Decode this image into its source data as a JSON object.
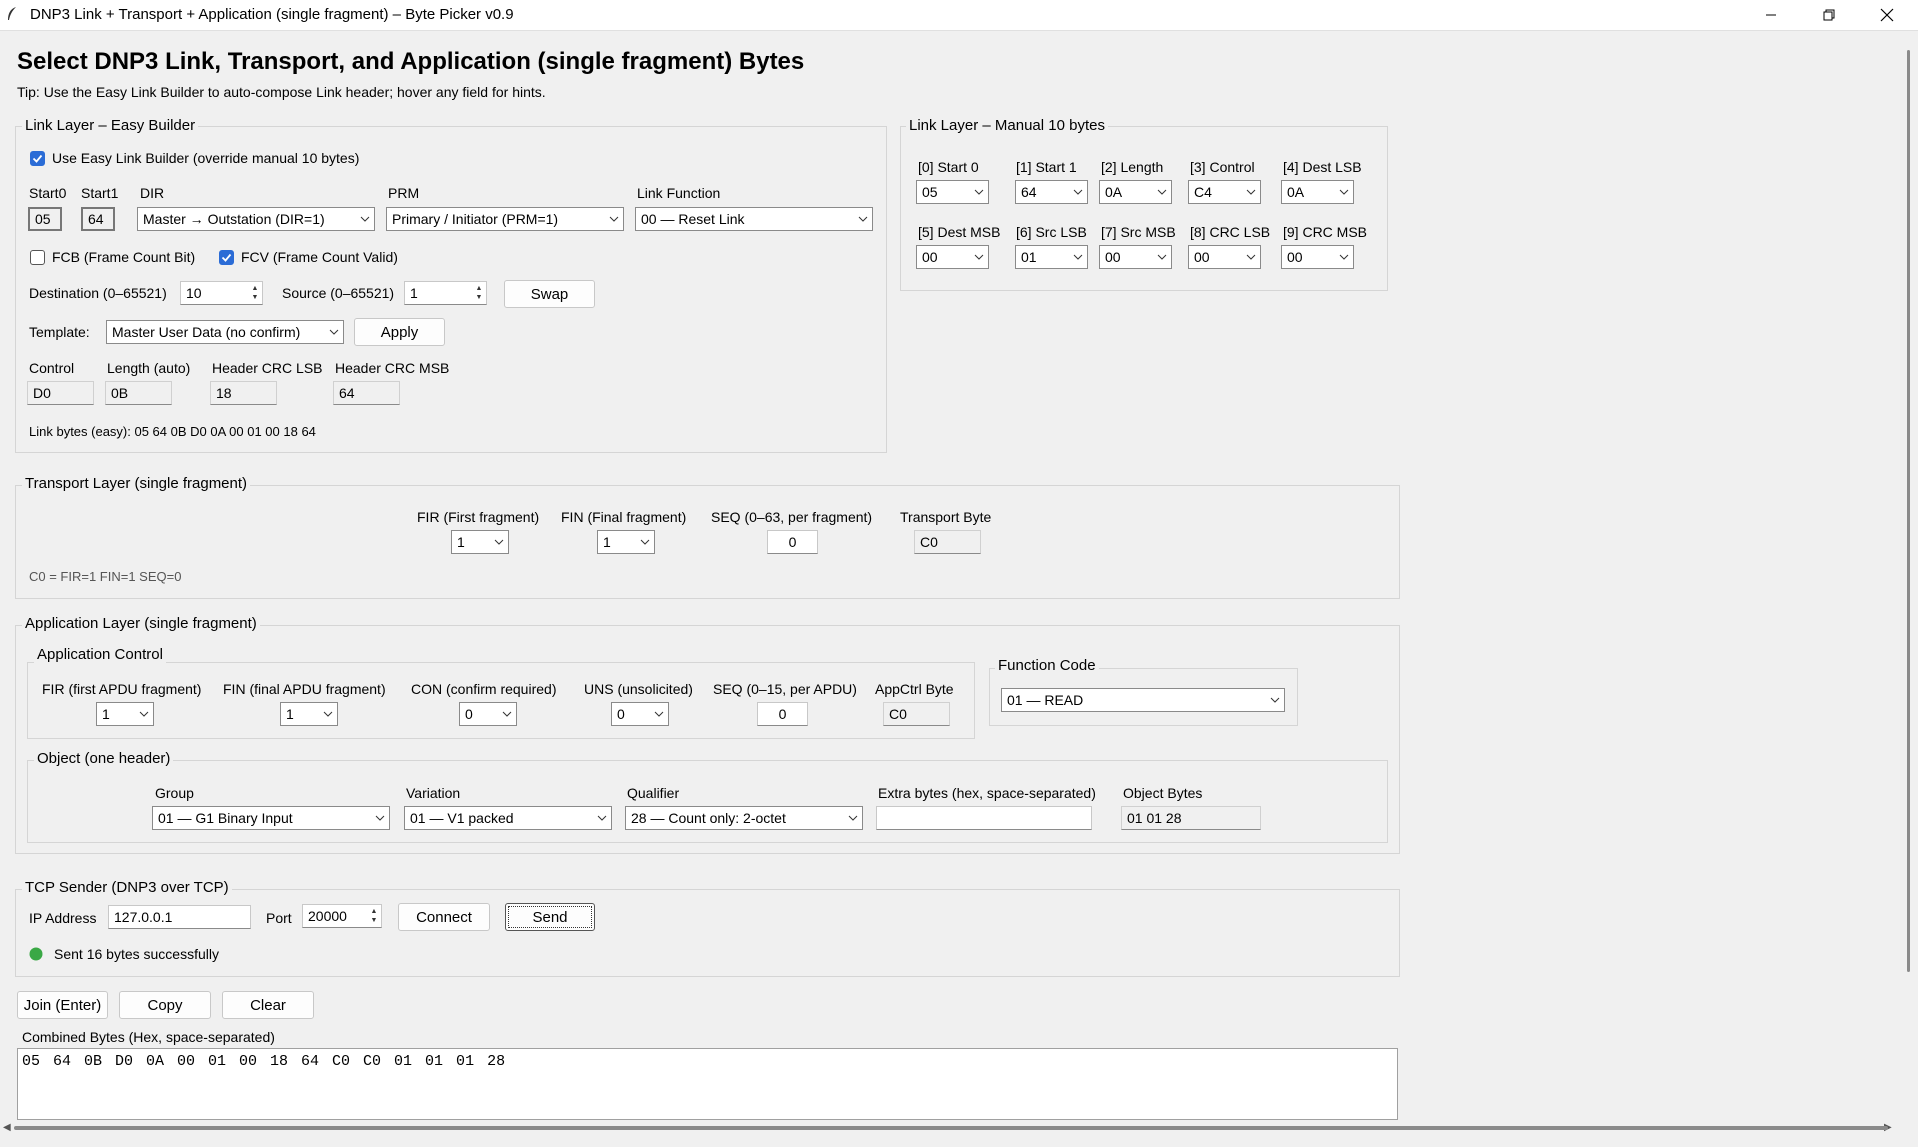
{
  "window": {
    "title": "DNP3 Link + Transport + Application (single fragment) – Byte Picker v0.9"
  },
  "heading": "Select DNP3 Link, Transport, and Application (single fragment) Bytes",
  "tip": "Tip: Use the Easy Link Builder to auto-compose Link header; hover any field for hints.",
  "easy": {
    "frame_title": "Link Layer – Easy Builder",
    "use_easy_label": "Use Easy Link Builder (override manual 10 bytes)",
    "use_easy_checked": true,
    "start0_label": "Start0",
    "start0": "05",
    "start1_label": "Start1",
    "start1": "64",
    "dir_label": "DIR",
    "dir": "Master → Outstation (DIR=1)",
    "prm_label": "PRM",
    "prm": "Primary / Initiator (PRM=1)",
    "linkfn_label": "Link Function",
    "linkfn": "00 — Reset Link",
    "fcb_label": "FCB (Frame Count Bit)",
    "fcb_checked": false,
    "fcv_label": "FCV (Frame Count Valid)",
    "fcv_checked": true,
    "dest_label": "Destination (0–65521)",
    "dest": "10",
    "src_label": "Source (0–65521)",
    "src": "1",
    "swap_label": "Swap",
    "template_label": "Template:",
    "template": "Master User Data (no confirm)",
    "apply_label": "Apply",
    "control_label": "Control",
    "control": "D0",
    "length_label": "Length (auto)",
    "length": "0B",
    "crc_lsb_label": "Header CRC LSB",
    "crc_lsb": "18",
    "crc_msb_label": "Header CRC MSB",
    "crc_msb": "64",
    "link_bytes": "Link bytes (easy): 05 64 0B D0 0A 00 01 00 18 64"
  },
  "manual": {
    "frame_title": "Link Layer – Manual 10 bytes",
    "fields": [
      {
        "label": "[0] Start 0",
        "value": "05"
      },
      {
        "label": "[1] Start 1",
        "value": "64"
      },
      {
        "label": "[2] Length",
        "value": "0A"
      },
      {
        "label": "[3] Control",
        "value": "C4"
      },
      {
        "label": "[4] Dest LSB",
        "value": "0A"
      },
      {
        "label": "[5] Dest MSB",
        "value": "00"
      },
      {
        "label": "[6] Src LSB",
        "value": "01"
      },
      {
        "label": "[7] Src MSB",
        "value": "00"
      },
      {
        "label": "[8] CRC LSB",
        "value": "00"
      },
      {
        "label": "[9] CRC MSB",
        "value": "00"
      }
    ]
  },
  "transport": {
    "frame_title": "Transport Layer (single fragment)",
    "fir_label": "FIR (First fragment)",
    "fir": "1",
    "fin_label": "FIN (Final fragment)",
    "fin": "1",
    "seq_label": "SEQ (0–63, per fragment)",
    "seq": "0",
    "byte_label": "Transport Byte",
    "byte": "C0",
    "summary": "C0 = FIR=1 FIN=1 SEQ=0"
  },
  "app": {
    "frame_title": "Application Layer (single fragment)",
    "control_title": "Application Control",
    "fir_label": "FIR (first APDU fragment)",
    "fir": "1",
    "fin_label": "FIN (final APDU fragment)",
    "fin": "1",
    "con_label": "CON (confirm required)",
    "con": "0",
    "uns_label": "UNS (unsolicited)",
    "uns": "0",
    "seq_label": "SEQ (0–15, per APDU)",
    "seq": "0",
    "ctrl_byte_label": "AppCtrl Byte",
    "ctrl_byte": "C0",
    "fc_title": "Function Code",
    "fc": "01  —  READ",
    "object_title": "Object (one header)",
    "group_label": "Group",
    "group": "01  —  G1 Binary Input",
    "variation_label": "Variation",
    "variation": "01  —  V1 packed",
    "qualifier_label": "Qualifier",
    "qualifier": "28  —  Count only: 2-octet",
    "extra_label": "Extra bytes (hex, space-separated)",
    "extra": "",
    "objbytes_label": "Object Bytes",
    "objbytes": "01 01 28"
  },
  "tcp": {
    "frame_title": "TCP Sender (DNP3 over TCP)",
    "ip_label": "IP Address",
    "ip": "127.0.0.1",
    "port_label": "Port",
    "port": "20000",
    "connect_label": "Connect",
    "send_label": "Send",
    "status_color": "#3aa845",
    "status": "Sent 16 bytes successfully"
  },
  "actions": {
    "join": "Join (Enter)",
    "copy": "Copy",
    "clear": "Clear"
  },
  "combined": {
    "label": "Combined Bytes (Hex, space-separated)",
    "value": "05 64 0B D0 0A 00 01 00 18 64 C0 C0 01 01 01 28"
  }
}
